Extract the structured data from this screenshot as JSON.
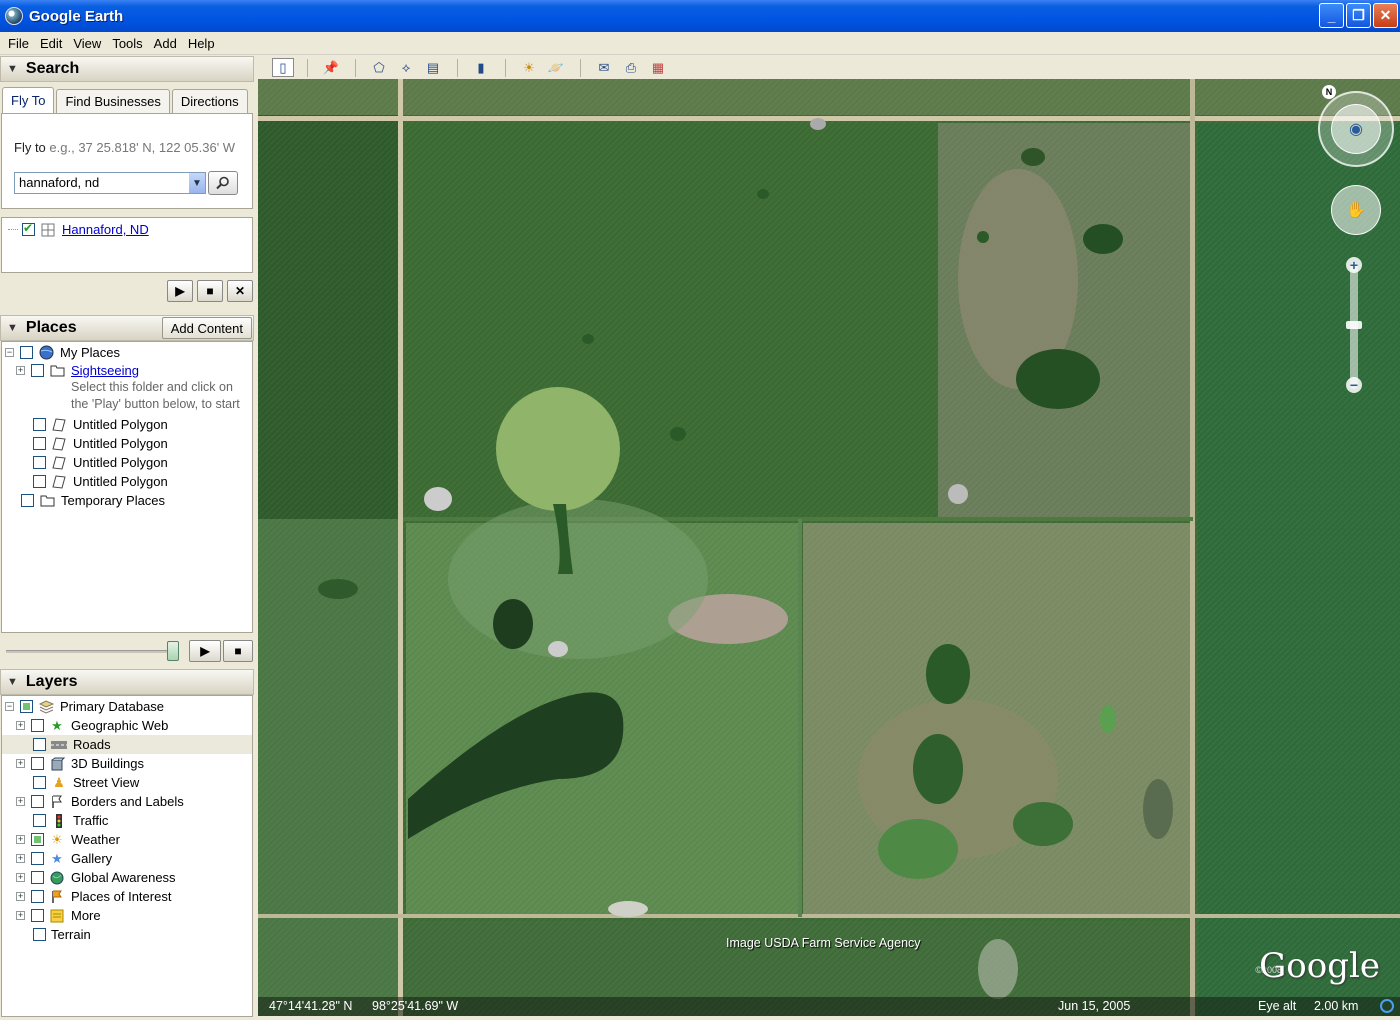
{
  "window": {
    "title": "Google Earth",
    "minimize": "_",
    "maximize": "❐",
    "close": "✕"
  },
  "menu": [
    "File",
    "Edit",
    "View",
    "Tools",
    "Add",
    "Help"
  ],
  "search": {
    "header": "Search",
    "tabs": [
      "Fly To",
      "Find Businesses",
      "Directions"
    ],
    "flyto_label": "Fly to",
    "flyto_hint": "e.g., 37 25.818' N, 122 05.36' W",
    "input_value": "hannaford, nd",
    "result": "Hannaford, ND"
  },
  "places": {
    "header": "Places",
    "add_content": "Add Content",
    "items": [
      {
        "label": "My Places"
      },
      {
        "label": "Sightseeing"
      },
      {
        "label": "Untitled Polygon"
      },
      {
        "label": "Untitled Polygon"
      },
      {
        "label": "Untitled Polygon"
      },
      {
        "label": "Untitled Polygon"
      },
      {
        "label": "Temporary Places"
      }
    ],
    "note_line1": "Select this folder and click on",
    "note_line2": "the 'Play' button below, to start"
  },
  "layers": {
    "header": "Layers",
    "items": [
      {
        "label": "Primary Database"
      },
      {
        "label": "Geographic Web"
      },
      {
        "label": "Roads"
      },
      {
        "label": "3D Buildings"
      },
      {
        "label": "Street View"
      },
      {
        "label": "Borders and Labels"
      },
      {
        "label": "Traffic"
      },
      {
        "label": "Weather"
      },
      {
        "label": "Gallery"
      },
      {
        "label": "Global Awareness"
      },
      {
        "label": "Places of Interest"
      },
      {
        "label": "More"
      },
      {
        "label": "Terrain"
      }
    ]
  },
  "map": {
    "credit": "Image USDA Farm Service Agency",
    "logo": "Google",
    "copyright": "©2008",
    "lat": "47°14'41.28\" N",
    "lon": "98°25'41.69\" W",
    "date": "Jun 15, 2005",
    "eye_alt_label": "Eye alt",
    "eye_alt_value": "2.00 km",
    "north": "N"
  }
}
